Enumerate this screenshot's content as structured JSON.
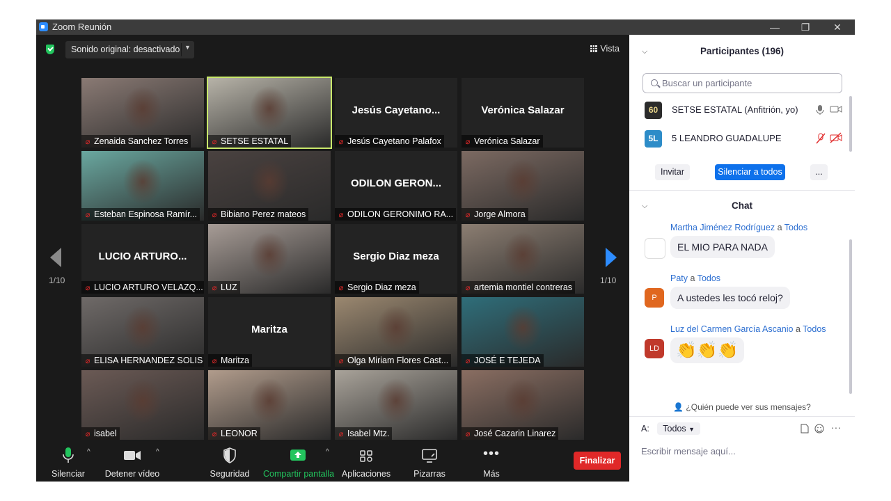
{
  "window": {
    "title": "Zoom Reunión"
  },
  "top_bar": {
    "sound_label": "Sonido original: desactivado",
    "view_label": "Vista"
  },
  "pagination": {
    "left": "1/10",
    "right": "1/10"
  },
  "tiles": [
    {
      "name": "Zenaida Sanchez Torres",
      "big": "",
      "mode": "photo",
      "bg": "#8a7a74"
    },
    {
      "name": "SETSE ESTATAL",
      "big": "",
      "mode": "photo",
      "bg": "#b7b3a8",
      "active": true
    },
    {
      "name": "Jesús Cayetano Palafox",
      "big": "Jesús  Cayetano...",
      "mode": "text"
    },
    {
      "name": "Verónica Salazar",
      "big": "Verónica Salazar",
      "mode": "text"
    },
    {
      "name": "Esteban Espinosa Ramír...",
      "big": "",
      "mode": "photo",
      "bg": "#6aa8a0"
    },
    {
      "name": "Bibiano Perez  mateos",
      "big": "",
      "mode": "photo",
      "bg": "#4a4240"
    },
    {
      "name": "ODILON GERONIMO RA...",
      "big": "ODILON  GERON...",
      "mode": "text"
    },
    {
      "name": "Jorge Almora",
      "big": "",
      "mode": "photo",
      "bg": "#7c6a62"
    },
    {
      "name": "LUCIO ARTURO VELAZQ...",
      "big": "LUCIO ARTURO...",
      "mode": "text"
    },
    {
      "name": "LUZ",
      "big": "",
      "mode": "photo",
      "bg": "#a79c96"
    },
    {
      "name": "Sergio Diaz meza",
      "big": "Sergio Diaz meza",
      "mode": "text"
    },
    {
      "name": "artemia montiel contreras",
      "big": "",
      "mode": "photo",
      "bg": "#8c7e72"
    },
    {
      "name": "ELISA HERNANDEZ SOLIS",
      "big": "",
      "mode": "photo",
      "bg": "#6f6a68"
    },
    {
      "name": "Maritza",
      "big": "Maritza",
      "mode": "text"
    },
    {
      "name": "Olga Miriam Flores Cast...",
      "big": "",
      "mode": "photo",
      "bg": "#9b8870"
    },
    {
      "name": "JOSÉ  E TEJEDA",
      "big": "",
      "mode": "photo",
      "bg": "#2f6e7a"
    },
    {
      "name": "isabel",
      "big": "",
      "mode": "photo",
      "bg": "#6b5a55"
    },
    {
      "name": "LEONOR",
      "big": "",
      "mode": "photo",
      "bg": "#b19c8c"
    },
    {
      "name": "Isabel Mtz.",
      "big": "",
      "mode": "photo",
      "bg": "#a9a39a"
    },
    {
      "name": "José Cazarin Linarez",
      "big": "",
      "mode": "photo",
      "bg": "#8a6e62"
    }
  ],
  "toolbar": {
    "mute": "Silenciar",
    "video": "Detener vídeo",
    "security": "Seguridad",
    "share": "Compartir pantalla",
    "apps": "Aplicaciones",
    "whiteboards": "Pizarras",
    "more": "Más",
    "end": "Finalizar"
  },
  "participants": {
    "title": "Participantes (196)",
    "search_placeholder": "Buscar un participante",
    "list": [
      {
        "avatar": "60",
        "name": "SETSE ESTATAL (Anfitrión, yo)"
      },
      {
        "avatar": "5L",
        "name": "5 LEANDRO GUADALUPE"
      }
    ],
    "invite": "Invitar",
    "mute_all": "Silenciar a todos",
    "more": "..."
  },
  "chat": {
    "title": "Chat",
    "messages": [
      {
        "from": "Martha Jiménez Rodríguez",
        "to_word": "a",
        "to": "Todos",
        "text": "EL MIO PARA NADA",
        "avatar": ""
      },
      {
        "from": "Paty",
        "to_word": "a",
        "to": "Todos",
        "text": "A ustedes les tocó reloj?",
        "avatar": "P"
      },
      {
        "from": "Luz del Carmen García Ascanio",
        "to_word": "a",
        "to": "Todos",
        "text": "👏👏👏",
        "avatar": "LD"
      }
    ],
    "who_can_see": "¿Quién puede ver sus mensajes?",
    "to_label": "A:",
    "to_value": "Todos",
    "compose_placeholder": "Escribir mensaje aquí..."
  },
  "colors": {
    "accent": "#0e71eb",
    "end": "#e02828",
    "share": "#23c55e",
    "active_speaker": "#c9e86b"
  }
}
